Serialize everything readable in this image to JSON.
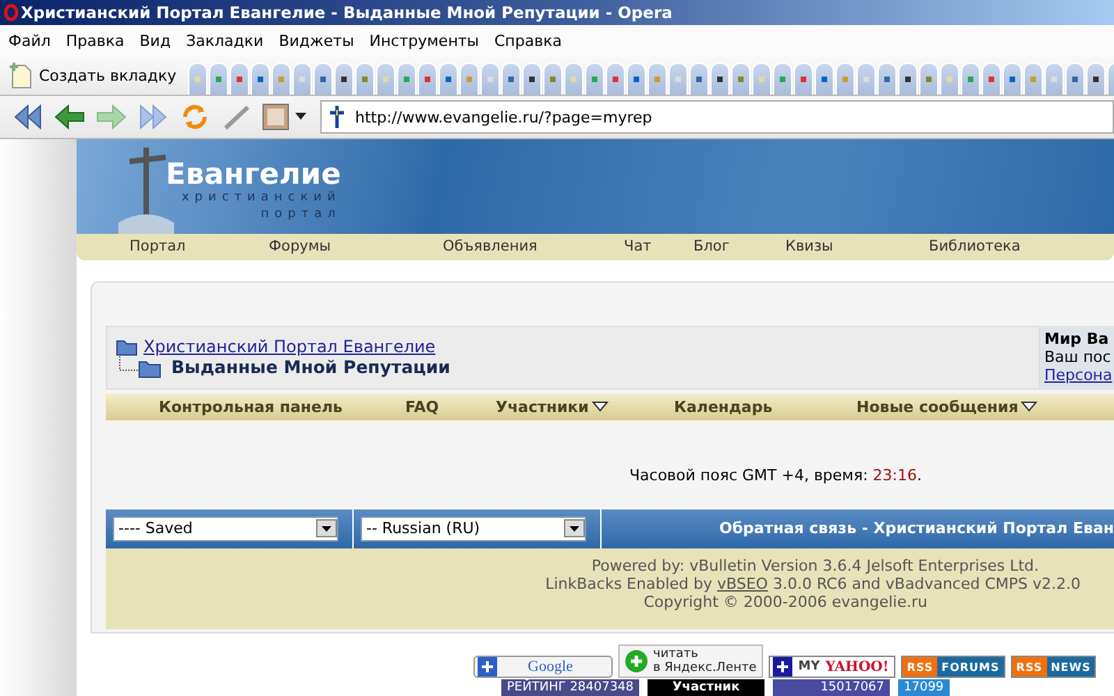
{
  "window": {
    "title": "Христианский Портал Евангелие - Выданные Мной Репутации - Opera"
  },
  "menu": [
    "Файл",
    "Правка",
    "Вид",
    "Закладки",
    "Виджеты",
    "Инструменты",
    "Справка"
  ],
  "tab_bar": {
    "new_tab": "Создать вкладку",
    "tabs": [
      {
        "selected": false
      },
      {
        "selected": false
      },
      {
        "selected": false
      },
      {
        "selected": false
      },
      {
        "selected": false
      },
      {
        "selected": false
      },
      {
        "selected": false
      },
      {
        "selected": false
      },
      {
        "selected": false
      },
      {
        "selected": false
      },
      {
        "selected": false
      },
      {
        "selected": false
      },
      {
        "selected": false
      },
      {
        "selected": false
      },
      {
        "selected": false
      },
      {
        "selected": false
      },
      {
        "selected": false
      },
      {
        "selected": false
      },
      {
        "selected": false
      },
      {
        "selected": false
      },
      {
        "selected": false
      },
      {
        "selected": false
      },
      {
        "selected": false
      },
      {
        "selected": false
      },
      {
        "selected": false
      },
      {
        "selected": false
      },
      {
        "selected": false
      },
      {
        "selected": false
      },
      {
        "selected": false
      },
      {
        "selected": false
      },
      {
        "selected": false
      },
      {
        "selected": false
      },
      {
        "selected": false
      },
      {
        "selected": false
      },
      {
        "selected": false
      },
      {
        "selected": false
      },
      {
        "selected": false
      },
      {
        "selected": false
      },
      {
        "selected": false
      },
      {
        "selected": false
      },
      {
        "selected": false
      },
      {
        "selected": false
      },
      {
        "selected": false
      },
      {
        "selected": false
      },
      {
        "selected": false
      }
    ]
  },
  "address": "http://www.evangelie.ru/?page=myrep",
  "site": {
    "logo": "Евангелие",
    "tagline_1": "христианский",
    "tagline_2": "портал",
    "nav": [
      "Портал",
      "Форумы",
      "Объявления",
      "Чат",
      "Блог",
      "Квизы",
      "Библиотека"
    ]
  },
  "breadcrumb": {
    "parent": "Христианский Портал Евангелие",
    "current": "Выданные Мной Репутации"
  },
  "user_panel": {
    "greeting": "Мир Ва",
    "line": "Ваш пос",
    "link": "Персона"
  },
  "navbar": [
    {
      "label": "Контрольная панель",
      "dropdown": false
    },
    {
      "label": "FAQ",
      "dropdown": false
    },
    {
      "label": "Участники",
      "dropdown": true
    },
    {
      "label": "Календарь",
      "dropdown": false
    },
    {
      "label": "Новые сообщения",
      "dropdown": true
    }
  ],
  "timezone": {
    "text": "Часовой пояс GMT +4, время: ",
    "time": "23:16",
    "end": "."
  },
  "footer": {
    "style_select": "---- Saved",
    "language_select": "-- Russian (RU)",
    "link": "Обратная связь - Христианский Портал Еван"
  },
  "copyright": {
    "line_1": "Powered by: vBulletin Version 3.6.4 Jelsoft Enterprises Ltd.",
    "line_2_before": "LinkBacks Enabled by ",
    "line_2_link": "vBSEO",
    "line_2_after": " 3.0.0 RC6 and vBadvanced CMPS v2.2.0",
    "line_3": "Copyright © 2000-2006 evangelie.ru"
  },
  "badges": [
    {
      "kind": "google",
      "text": "Google"
    },
    {
      "kind": "yandex",
      "text": "читать",
      "text_2": "в Яндекс.Ленте"
    },
    {
      "kind": "yahoo",
      "text": "MY",
      "text_2": "YAHOO!"
    },
    {
      "kind": "rss",
      "text": "RSS",
      "text_2": "FORUMS"
    },
    {
      "kind": "rss",
      "text": "RSS",
      "text_2": "NEWS"
    }
  ],
  "counters": [
    {
      "kind": "rating",
      "text": "РЕЙТИНГ  28407348"
    },
    {
      "kind": "member",
      "text": "Участник"
    },
    {
      "kind": "hits",
      "text": "15017067"
    },
    {
      "kind": "logo",
      "text": "17099"
    }
  ]
}
